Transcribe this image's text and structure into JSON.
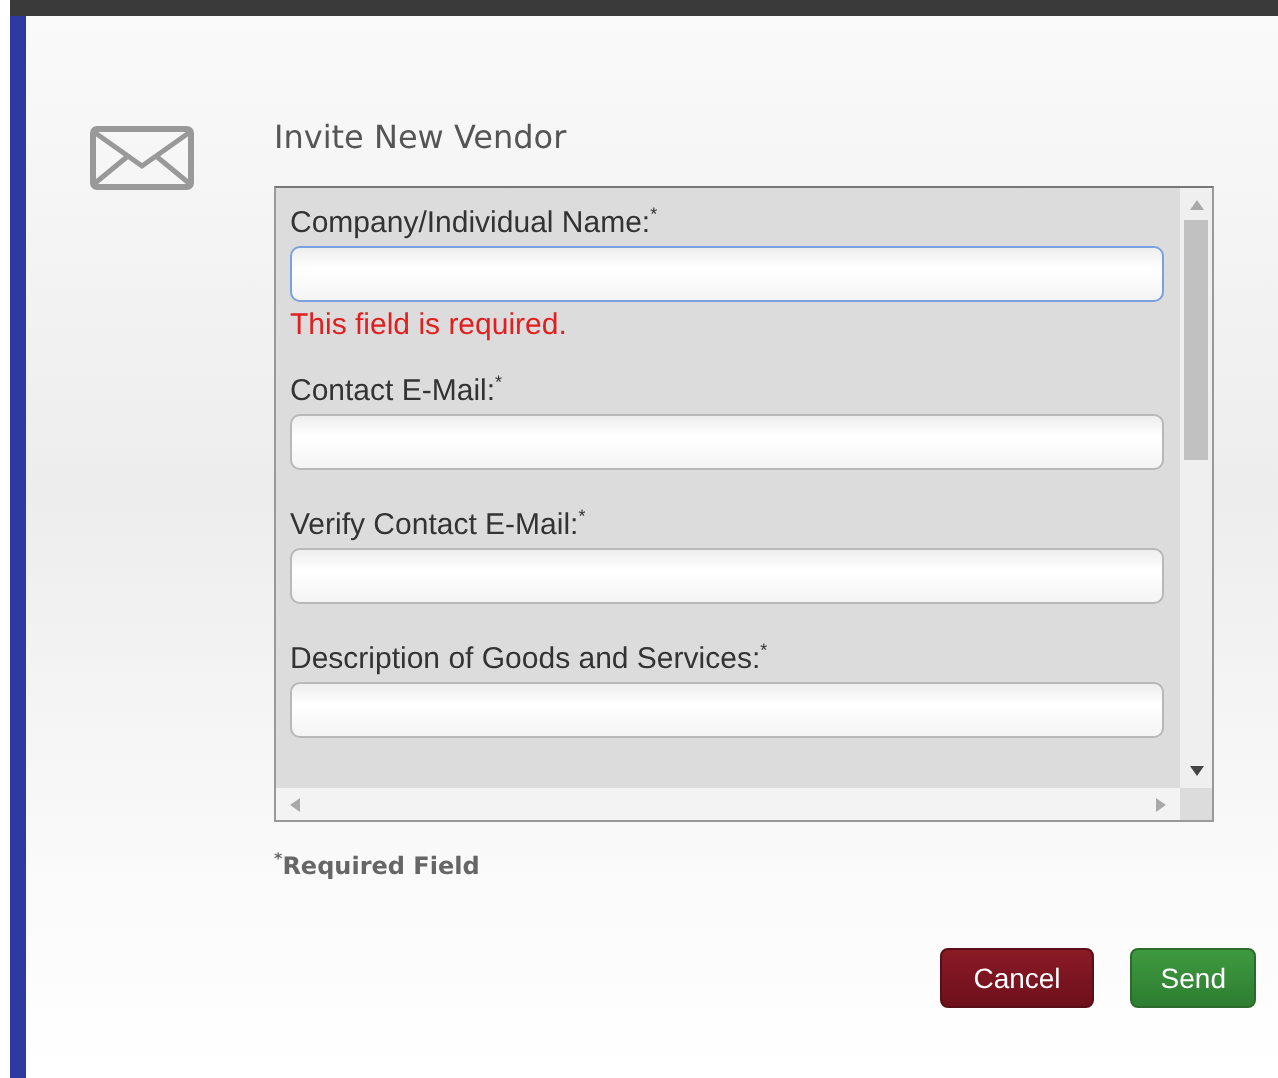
{
  "dialog": {
    "title": "Invite New Vendor",
    "fields": [
      {
        "label": "Company/Individual Name:",
        "required_mark": "*",
        "focused": true,
        "error": "This field is required."
      },
      {
        "label": "Contact E-Mail:",
        "required_mark": "*",
        "focused": false
      },
      {
        "label": "Verify Contact E-Mail:",
        "required_mark": "*",
        "focused": false
      },
      {
        "label": "Description of Goods and Services:",
        "required_mark": "*",
        "focused": false
      }
    ],
    "footnote": {
      "mark": "*",
      "text": "Required Field"
    },
    "buttons": [
      {
        "label": "Cancel",
        "kind": "cancel"
      },
      {
        "label": "Send",
        "kind": "send"
      }
    ]
  }
}
